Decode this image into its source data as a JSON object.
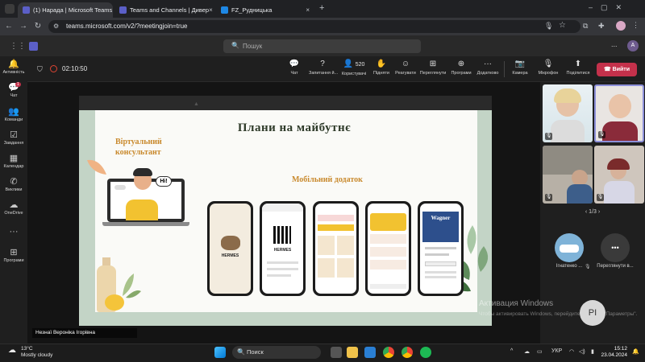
{
  "browser": {
    "tabs": [
      {
        "title": "(1) Нарада | Microsoft Teams",
        "close": "×"
      },
      {
        "title": "Teams and Channels | Дивер",
        "close": "×"
      },
      {
        "title": "FZ_Рудницька",
        "close": "×"
      }
    ],
    "url": "teams.microsoft.com/v2/?meetingjoin=true",
    "new_tab": "+"
  },
  "teams": {
    "search_placeholder": "Пошук",
    "more": "...",
    "avatar_initial": "A"
  },
  "rail": [
    {
      "label": "Активність",
      "icon": "bell-icon"
    },
    {
      "label": "Чат",
      "icon": "chat-icon",
      "badge": "1"
    },
    {
      "label": "Команди",
      "icon": "teams-icon"
    },
    {
      "label": "Завдання",
      "icon": "tasks-icon"
    },
    {
      "label": "Календар",
      "icon": "calendar-icon"
    },
    {
      "label": "Виклики",
      "icon": "phone-icon"
    },
    {
      "label": "OneDrive",
      "icon": "cloud-icon"
    },
    {
      "label": "Програми",
      "icon": "apps-icon"
    }
  ],
  "meeting": {
    "timer": "02:10:50",
    "tools": [
      {
        "label": "Чат",
        "glyph": "💬"
      },
      {
        "label": "Запитання й...",
        "glyph": "?"
      },
      {
        "label": "Користувачі",
        "glyph": "👤",
        "count": "520"
      },
      {
        "label": "Підняти",
        "glyph": "✋"
      },
      {
        "label": "Реагувати",
        "glyph": "☺"
      },
      {
        "label": "Переглянути",
        "glyph": "⊞"
      },
      {
        "label": "Програми",
        "glyph": "⊕"
      },
      {
        "label": "Додатково",
        "glyph": "···"
      },
      {
        "label": "Камера",
        "glyph": "📷"
      },
      {
        "label": "Мікрофон",
        "glyph": "🎙"
      },
      {
        "label": "Поділитися",
        "glyph": "⬆"
      }
    ],
    "leave_label": "Вийти",
    "presenter_caption": "Незнаї Вероніка Ігорівна"
  },
  "slide": {
    "title": "Плани на майбутнє",
    "virtual_consultant": "Віртуальний консультант",
    "mobile_app": "Мобільний додаток",
    "speech_bubble": "Hi!",
    "brand": "HERMES",
    "brand2": "Wagner"
  },
  "panel": {
    "pager": "1/3",
    "participants": [
      {
        "name": "Ігнатенко ..."
      },
      {
        "name": "Переглянути в..."
      }
    ],
    "more_glyph": "•••",
    "pi_initials": "PI"
  },
  "watermark": {
    "title": "Активация Windows",
    "text": "Чтобы активировать Windows, перейдите в раздел \"Параметры\"."
  },
  "taskbar": {
    "weather_temp": "13°C",
    "weather_desc": "Mostly cloudy",
    "search": "Поиск",
    "lang": "УКР",
    "time": "15:12",
    "date": "23.04.2024"
  }
}
